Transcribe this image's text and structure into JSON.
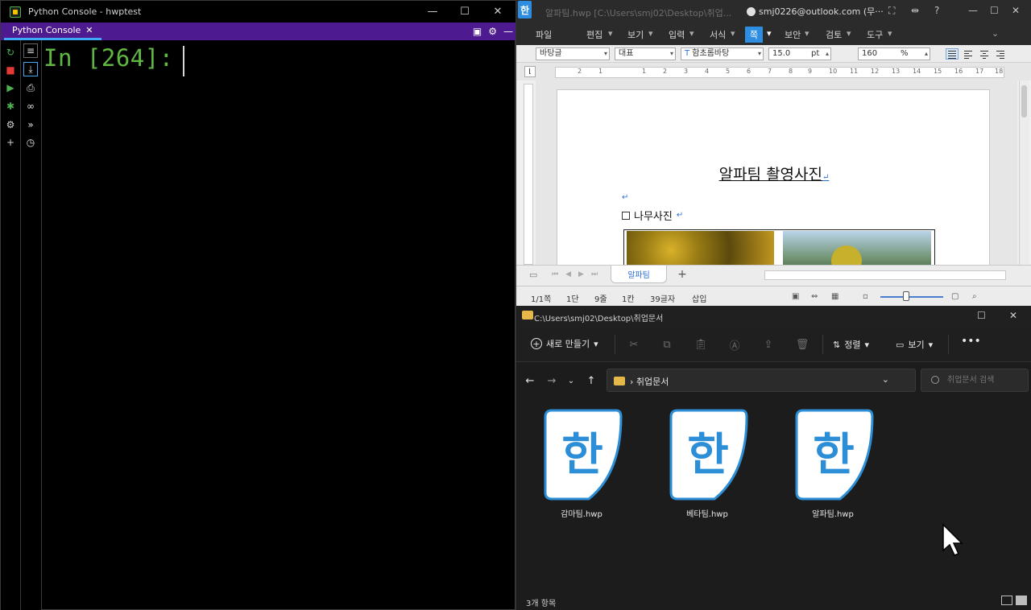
{
  "python_console": {
    "window_title": "Python Console - hwptest",
    "tab_label": "Python Console",
    "prompt": "In [264]:"
  },
  "hwp": {
    "app_glyph": "한",
    "doc_title": "알파팀.hwp [C:\\Users\\smj02\\Desktop\\취업...",
    "account": "smj0226@outlook.com (무···",
    "menu": [
      "파일",
      "편집",
      "보기",
      "입력",
      "서식",
      "쪽",
      "보안",
      "검토",
      "도구"
    ],
    "active_menu": "쪽",
    "format": {
      "style": "바탕글",
      "language": "대표",
      "font": "함초롬바탕",
      "size": "15.0",
      "size_unit": "pt",
      "ratio": "160",
      "ratio_unit": "%"
    },
    "ruler_ticks": [
      "2",
      "1",
      "1",
      "2",
      "3",
      "4",
      "5",
      "6",
      "7",
      "8",
      "9",
      "10",
      "11",
      "12",
      "13",
      "14",
      "15",
      "16",
      "17",
      "18"
    ],
    "document": {
      "heading": "알파팀 촬영사진",
      "subheading": "나무사진"
    },
    "sheet_tab": "알파팀",
    "status": {
      "page": "1/1쪽",
      "section": "1단",
      "line": "9줄",
      "column": "1칸",
      "chars": "39글자",
      "mode": "삽입"
    }
  },
  "explorer": {
    "title_path": "C:\\Users\\smj02\\Desktop\\취업문서",
    "new_label": "새로 만들기",
    "sort_label": "정렬",
    "view_label": "보기",
    "breadcrumb": "취업문서",
    "search_placeholder": "취업문서 검색",
    "files": [
      {
        "name": "감마팀.hwp"
      },
      {
        "name": "베타팀.hwp"
      },
      {
        "name": "알파팀.hwp"
      }
    ],
    "file_icon_glyph": "한",
    "status": "3개 항목",
    "accent": "#2b8ed6"
  },
  "colors": {
    "console_prompt": "#5fb643",
    "console_tabbar": "#4d1a8f",
    "hwp_accent": "#2d8de0"
  }
}
